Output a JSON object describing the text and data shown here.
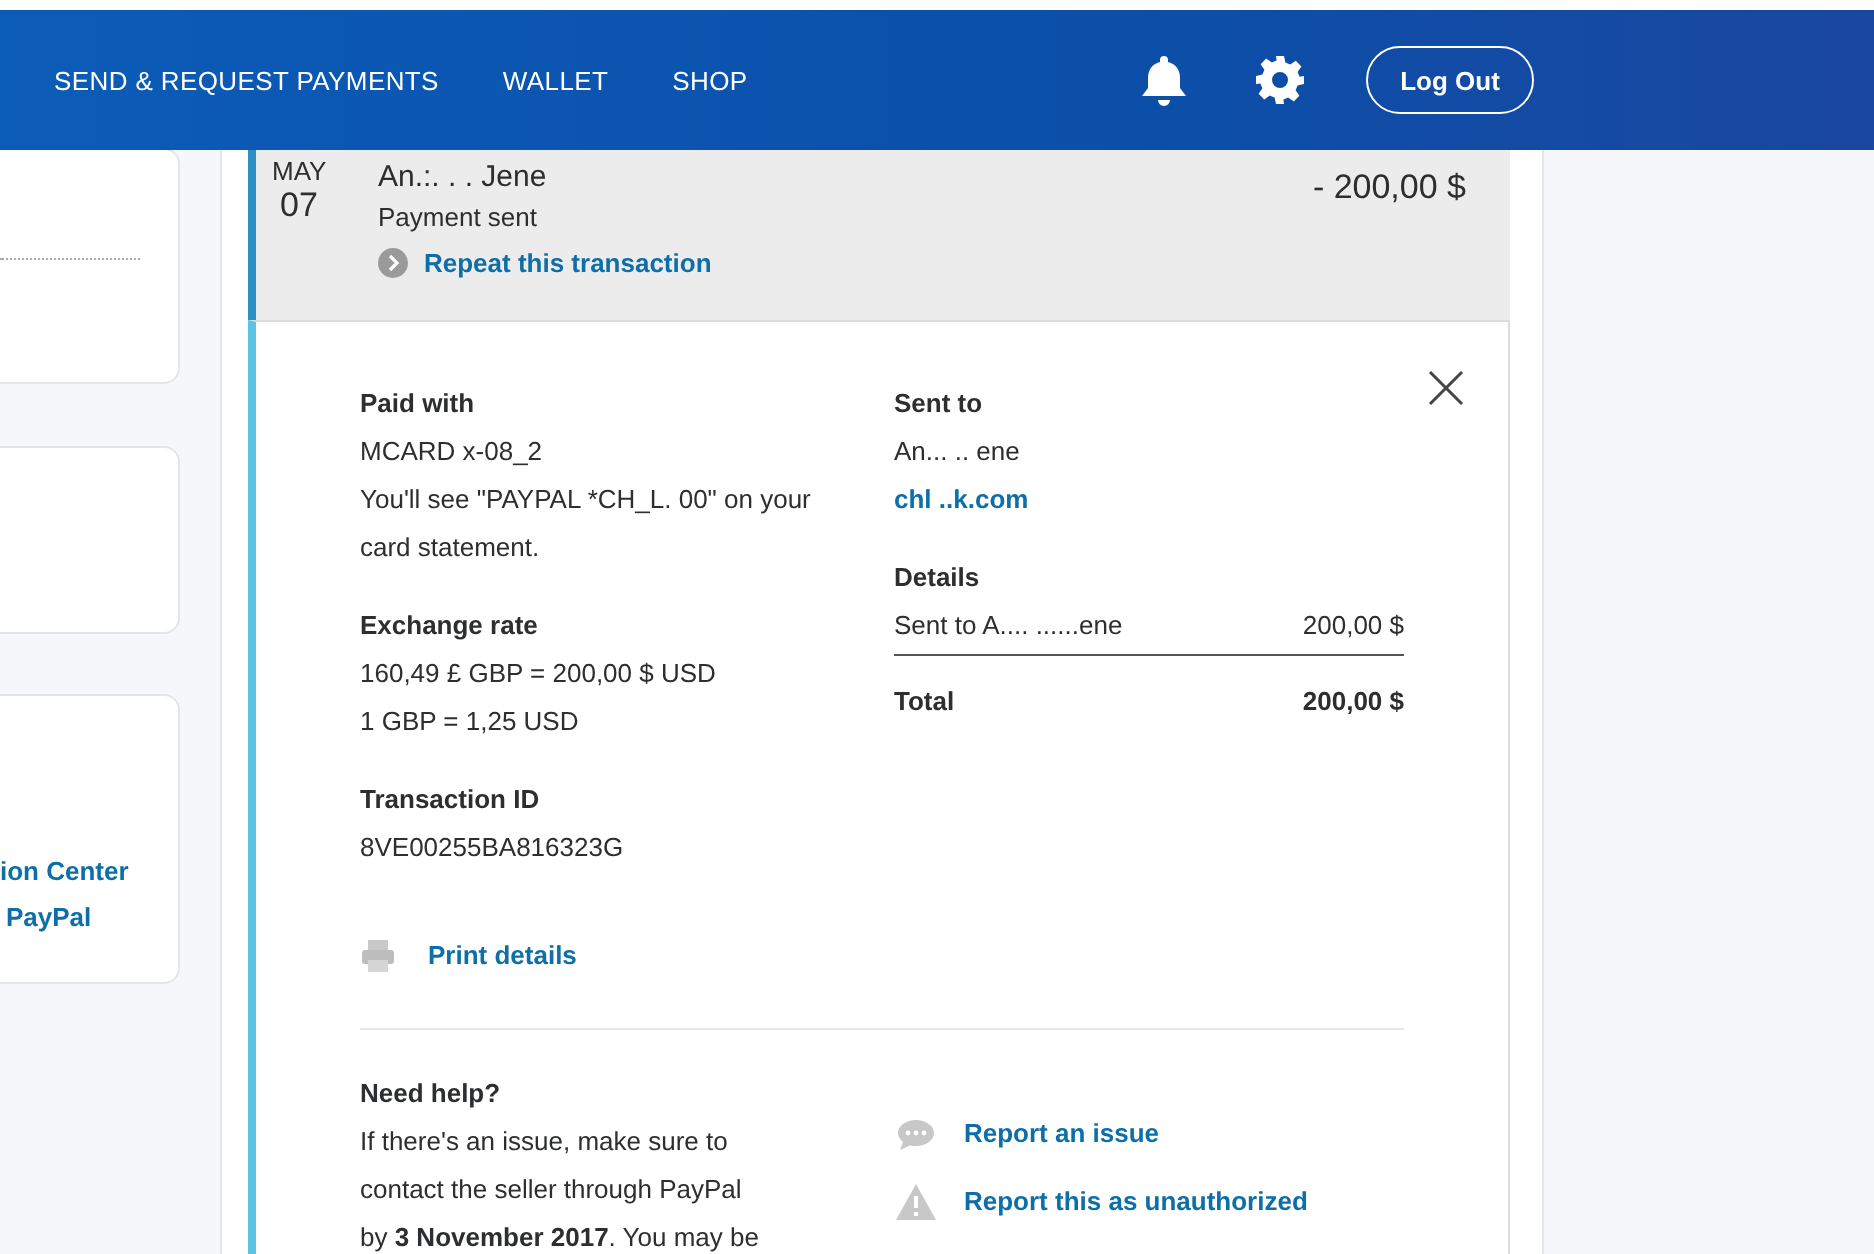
{
  "header": {
    "nav": [
      "SEND & REQUEST PAYMENTS",
      "WALLET",
      "SHOP"
    ],
    "logout": "Log Out"
  },
  "sidebar": {
    "links": [
      "ion Center",
      "PayPal"
    ]
  },
  "transaction": {
    "month": "MAY",
    "day": "07",
    "name": "An.:. . .  Jene",
    "status": "Payment sent",
    "amount": "- 200,00 $",
    "repeat": "Repeat this transaction"
  },
  "details": {
    "paid_with": {
      "heading": "Paid with",
      "card": "MCARD x-08_2",
      "statement": "You'll see \"PAYPAL *CH_L. 00\" on your card statement."
    },
    "exchange": {
      "heading": "Exchange rate",
      "lines": [
        "160,49 £ GBP = 200,00 $ USD",
        "1 GBP = 1,25 USD"
      ]
    },
    "transaction_id": {
      "heading": "Transaction ID",
      "value": "8VE00255BA816323G"
    },
    "print": "Print details",
    "sent_to": {
      "heading": "Sent to",
      "name": "An... .. ene",
      "email": "chl       ..k.com"
    },
    "breakdown": {
      "heading": "Details",
      "rows": [
        {
          "label": "Sent to A.... ......ene",
          "value": "200,00 $"
        }
      ],
      "total_label": "Total",
      "total_value": "200,00 $"
    },
    "help": {
      "heading": "Need help?",
      "text": "If there's an issue, make sure to contact the seller through PayPal by **3 November 2017**. You may be"
    },
    "actions": [
      {
        "kind": "report",
        "label": "Report an issue"
      },
      {
        "kind": "unauthorized",
        "label": "Report this as unauthorized"
      }
    ]
  }
}
